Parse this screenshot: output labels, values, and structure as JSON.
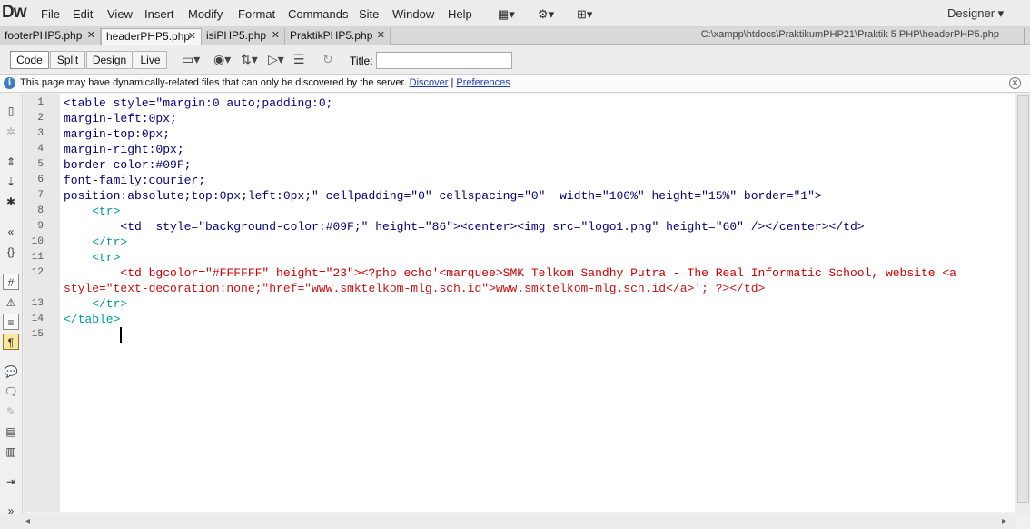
{
  "app": {
    "logo": "Dw"
  },
  "menu": [
    "File",
    "Edit",
    "View",
    "Insert",
    "Modify",
    "Format",
    "Commands",
    "Site",
    "Window",
    "Help"
  ],
  "menu_icons": [
    "layout-icon",
    "gear-icon",
    "sitemap-icon"
  ],
  "workspace": "Designer",
  "tabs": [
    {
      "label": "footerPHP5.php",
      "active": false
    },
    {
      "label": "headerPHP5.php",
      "active": true
    },
    {
      "label": "isiPHP5.php",
      "active": false
    },
    {
      "label": "PraktikPHP5.php",
      "active": false
    }
  ],
  "file_path": "C:\\xampp\\htdocs\\PraktikumPHP21\\Praktik 5 PHP\\headerPHP5.php",
  "view_buttons": [
    "Code",
    "Split",
    "Design",
    "Live"
  ],
  "selected_view": "Code",
  "title_label": "Title:",
  "title_value": "",
  "info_bar": {
    "text": "This page may have dynamically-related files that can only be discovered by the server.",
    "link1": "Discover",
    "sep": "|",
    "link2": "Preferences"
  },
  "line_numbers": [
    "1",
    "2",
    "3",
    "4",
    "5",
    "6",
    "7",
    "8",
    "9",
    "10",
    "11",
    "12",
    "",
    "13",
    "14",
    "15"
  ],
  "code_lines": [
    "<table style=\"margin:0 auto;padding:0;",
    "margin-left:0px;",
    "margin-top:0px;",
    "margin-right:0px;",
    "border-color:#09F;",
    "font-family:courier;",
    "position:absolute;top:0px;left:0px;\" cellpadding=\"0\" cellspacing=\"0\"  width=\"100%\" height=\"15%\" border=\"1\">",
    "    <tr>",
    "        <td  style=\"background-color:#09F;\" height=\"86\"><center><img src=\"logo1.png\" height=\"60\" /></center></td>",
    "    </tr>",
    "    <tr>",
    "        <td bgcolor=\"#FFFFFF\" height=\"23\"><?php echo'<marquee>SMK Telkom Sandhy Putra - The Real Informatic School, website <a",
    "style=\"text-decoration:none;\"href=\"www.smktelkom-mlg.sch.id\">www.smktelkom-mlg.sch.id</a>'; ?></td>",
    "    </tr>",
    "</table>",
    ""
  ]
}
